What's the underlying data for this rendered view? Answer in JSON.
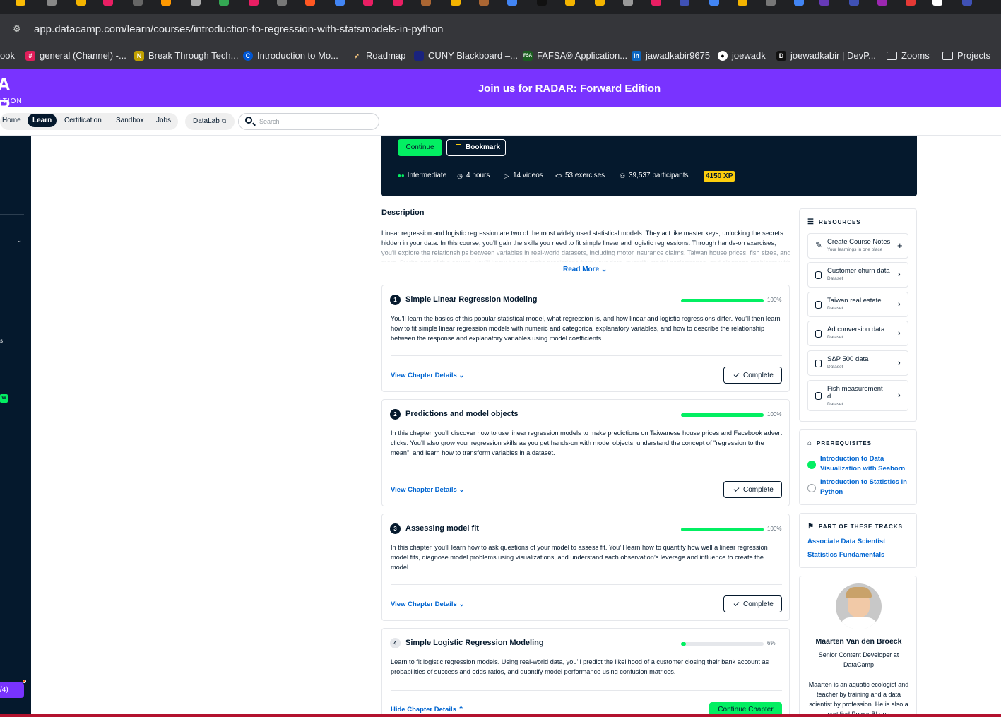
{
  "browser": {
    "url": "app.datacamp.com/learn/courses/introduction-to-regression-with-statsmodels-in-python",
    "bookmarks": [
      {
        "label": "ook",
        "icon": "facebook-icon"
      },
      {
        "label": "general (Channel) -...",
        "icon": "slack-icon"
      },
      {
        "label": "Break Through Tech...",
        "icon": "notion-icon"
      },
      {
        "label": "Introduction to Mo...",
        "icon": "coursera-icon"
      },
      {
        "label": "Roadmap",
        "icon": "rocket-icon"
      },
      {
        "label": "CUNY Blackboard –...",
        "icon": "blackboard-icon"
      },
      {
        "label": "FAFSA® Application...",
        "icon": "fsa-icon"
      },
      {
        "label": "jawadkabir9675",
        "icon": "linkedin-icon"
      },
      {
        "label": "joewadk",
        "icon": "github-icon"
      },
      {
        "label": "joewadkabir | DevP...",
        "icon": "devpost-icon"
      },
      {
        "label": "Zooms",
        "icon": "folder-icon"
      },
      {
        "label": "Projects",
        "icon": "folder-icon"
      }
    ]
  },
  "banner": {
    "logo_big": "A R",
    "logo_small": "ITION",
    "message": "Join us for RADAR: Forward Edition"
  },
  "nav": {
    "items": [
      "Home",
      "Learn",
      "Certification",
      "Sandbox",
      "Jobs"
    ],
    "active": "Learn",
    "datalab": "DataLab",
    "search_placeholder": "Search"
  },
  "sidebar": {
    "badge": "W",
    "progress_label": "/4)"
  },
  "hero": {
    "continue": "Continue",
    "bookmark": "Bookmark",
    "level": "Intermediate",
    "hours": "4 hours",
    "videos": "14 videos",
    "exercises": "53 exercises",
    "participants": "39,537 participants",
    "xp": "4150 XP"
  },
  "description": {
    "title": "Description",
    "text": "Linear regression and logistic regression are two of the most widely used statistical models. They act like master keys, unlocking the secrets hidden in your data. In this course, you’ll gain the skills you need to fit simple linear and logistic regressions. Through hands-on exercises, you’ll explore the relationships between variables in real-world datasets, including motor insurance claims, Taiwan house prices, fish sizes, and more. By the end of this course, you’ll know how to make predictions from your data, quantify model performance, and diagnose problems with model fit.",
    "read_more": "Read More"
  },
  "chapters": [
    {
      "num": "1",
      "title": "Simple Linear Regression Modeling",
      "progress": 1.0,
      "pct": "100%",
      "text": "You’ll learn the basics of this popular statistical model, what regression is, and how linear and logistic regressions differ. You’ll then learn how to fit simple linear regression models with numeric and categorical explanatory variables, and how to describe the relationship between the response and explanatory variables using model coefficients.",
      "details": "View Chapter Details",
      "action": "Complete"
    },
    {
      "num": "2",
      "title": "Predictions and model objects",
      "progress": 1.0,
      "pct": "100%",
      "text": "In this chapter, you’ll discover how to use linear regression models to make predictions on Taiwanese house prices and Facebook advert clicks. You’ll also grow your regression skills as you get hands-on with model objects, understand the concept of \"regression to the mean\", and learn how to transform variables in a dataset.",
      "details": "View Chapter Details",
      "action": "Complete"
    },
    {
      "num": "3",
      "title": "Assessing model fit",
      "progress": 1.0,
      "pct": "100%",
      "text": "In this chapter, you’ll learn how to ask questions of your model to assess fit. You’ll learn how to quantify how well a linear regression model fits, diagnose model problems using visualizations, and understand each observation’s leverage and influence to create the model.",
      "details": "View Chapter Details",
      "action": "Complete"
    },
    {
      "num": "4",
      "title": "Simple Logistic Regression Modeling",
      "progress": 0.06,
      "pct": "6%",
      "text": "Learn to fit logistic regression models. Using real-world data, you’ll predict the likelihood of a customer closing their bank account as probabilities of success and odds ratios, and quantify model performance using confusion matrices.",
      "details": "Hide Chapter Details",
      "action": "Continue Chapter"
    }
  ],
  "resources": {
    "title": "RESOURCES",
    "items": [
      {
        "name": "Create Course Notes",
        "sub": "Your learnings in one place",
        "icon": "edit-icon",
        "action": "plus-icon"
      },
      {
        "name": "Customer churn data",
        "sub": "Dataset",
        "icon": "database-icon",
        "action": "chevron-right-icon"
      },
      {
        "name": "Taiwan real estate...",
        "sub": "Dataset",
        "icon": "database-icon",
        "action": "chevron-right-icon"
      },
      {
        "name": "Ad conversion data",
        "sub": "Dataset",
        "icon": "database-icon",
        "action": "chevron-right-icon"
      },
      {
        "name": "S&P 500 data",
        "sub": "Dataset",
        "icon": "database-icon",
        "action": "chevron-right-icon"
      },
      {
        "name": "Fish measurement d...",
        "sub": "Dataset",
        "icon": "database-icon",
        "action": "chevron-right-icon"
      }
    ]
  },
  "prerequisites": {
    "title": "PREREQUISITES",
    "items": [
      {
        "name": "Introduction to Data Visualization with Seaborn",
        "done": true
      },
      {
        "name": "Introduction to Statistics in Python",
        "done": false
      }
    ]
  },
  "tracks": {
    "title": "PART OF THESE TRACKS",
    "items": [
      "Associate Data Scientist",
      "Statistics Fundamentals"
    ]
  },
  "instructor": {
    "name": "Maarten Van den Broeck",
    "role": "Senior Content Developer at DataCamp",
    "bio": "Maarten is an aquatic ecologist and teacher by training and a data scientist by profession. He is also a certified Power BI and"
  },
  "colors": {
    "brand_purple": "#7933ff",
    "navy": "#05192d",
    "green": "#03ef62",
    "link_blue": "#0065d1",
    "xp_yellow": "#fcce0d"
  }
}
